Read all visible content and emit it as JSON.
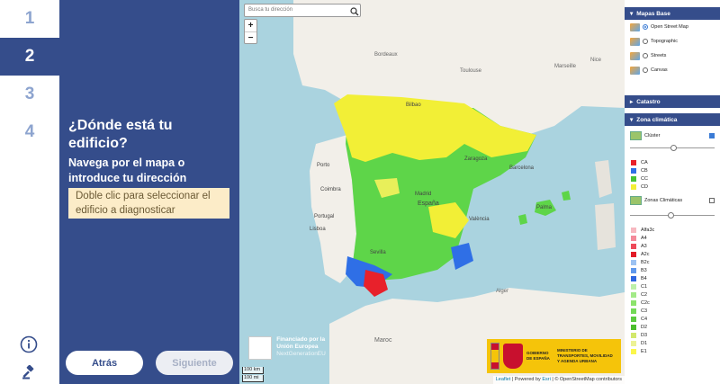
{
  "steps": [
    "1",
    "2",
    "3",
    "4"
  ],
  "active_step": 1,
  "panel": {
    "title": "¿Dónde está tu edificio?",
    "subtitle": "Navega por el mapa o introduce tu dirección",
    "hint": "Doble clic para seleccionar el edificio a diagnosticar",
    "back_label": "Atrás",
    "next_label": "Siguiente"
  },
  "map": {
    "search_placeholder": "Busca tu dirección",
    "zoom_in": "+",
    "zoom_out": "−",
    "eu_title": "Financiado por la Unión Europea",
    "eu_sub": "NextGenerationEU",
    "gov_main": "GOBIERNO DE ESPAÑA",
    "gov_ministry": "MINISTERIO DE TRANSPORTES, MOVILIDAD Y AGENDA URBANA",
    "scale_km": "100 km",
    "scale_mi": "100 mi",
    "attrib_leaflet": "Leaflet",
    "attrib_powered": "| Powered by",
    "attrib_esri": "Esri",
    "attrib_osm": "| © OpenStreetMap contributors",
    "places": [
      "Bordeaux",
      "Toulouse",
      "Marseille",
      "Barcelona",
      "Madrid",
      "España",
      "Portugal",
      "Lisboa",
      "Sevilla",
      "València",
      "Bilbao",
      "Zaragoza",
      "Palma",
      "Alger",
      "Maroc",
      "Porto",
      "Nice",
      "Coimbra"
    ]
  },
  "layers": {
    "base_title": "Mapas Base",
    "base_options": [
      "Open Street Map",
      "Topographic",
      "Streets",
      "Canvas"
    ],
    "base_selected": 0,
    "catastro": "Catastro",
    "zona_title": "Zona climática",
    "cluster_label": "Clúster",
    "cluster_legend": [
      {
        "label": "CA",
        "color": "#e8212b"
      },
      {
        "label": "CB",
        "color": "#2f6fe6"
      },
      {
        "label": "CC",
        "color": "#45c236"
      },
      {
        "label": "CD",
        "color": "#f2ef36"
      }
    ],
    "zonas_label": "Zonas Climáticas",
    "zonas_legend": [
      {
        "label": "Alfa3c",
        "color": "#f7b8c0"
      },
      {
        "label": "A4",
        "color": "#f48a9a"
      },
      {
        "label": "A3",
        "color": "#ee4a5a"
      },
      {
        "label": "A2c",
        "color": "#e21b27"
      },
      {
        "label": "B2c",
        "color": "#9cc2f2"
      },
      {
        "label": "B3",
        "color": "#5f98ec"
      },
      {
        "label": "B4",
        "color": "#2e66e0"
      },
      {
        "label": "C1",
        "color": "#bdf0a8"
      },
      {
        "label": "C2",
        "color": "#a3ea88"
      },
      {
        "label": "C2c",
        "color": "#8ce36c"
      },
      {
        "label": "C3",
        "color": "#74d957"
      },
      {
        "label": "C4",
        "color": "#5cca3f"
      },
      {
        "label": "D2",
        "color": "#4bbd2c"
      },
      {
        "label": "D3",
        "color": "#d2e86c"
      },
      {
        "label": "D1",
        "color": "#ecf295"
      },
      {
        "label": "E1",
        "color": "#fbf74a"
      }
    ]
  },
  "colors": {
    "brand_blue": "#354d8b",
    "hint_bg": "#fcecc8",
    "sea": "#aad3df",
    "land": "#f2efe9"
  }
}
